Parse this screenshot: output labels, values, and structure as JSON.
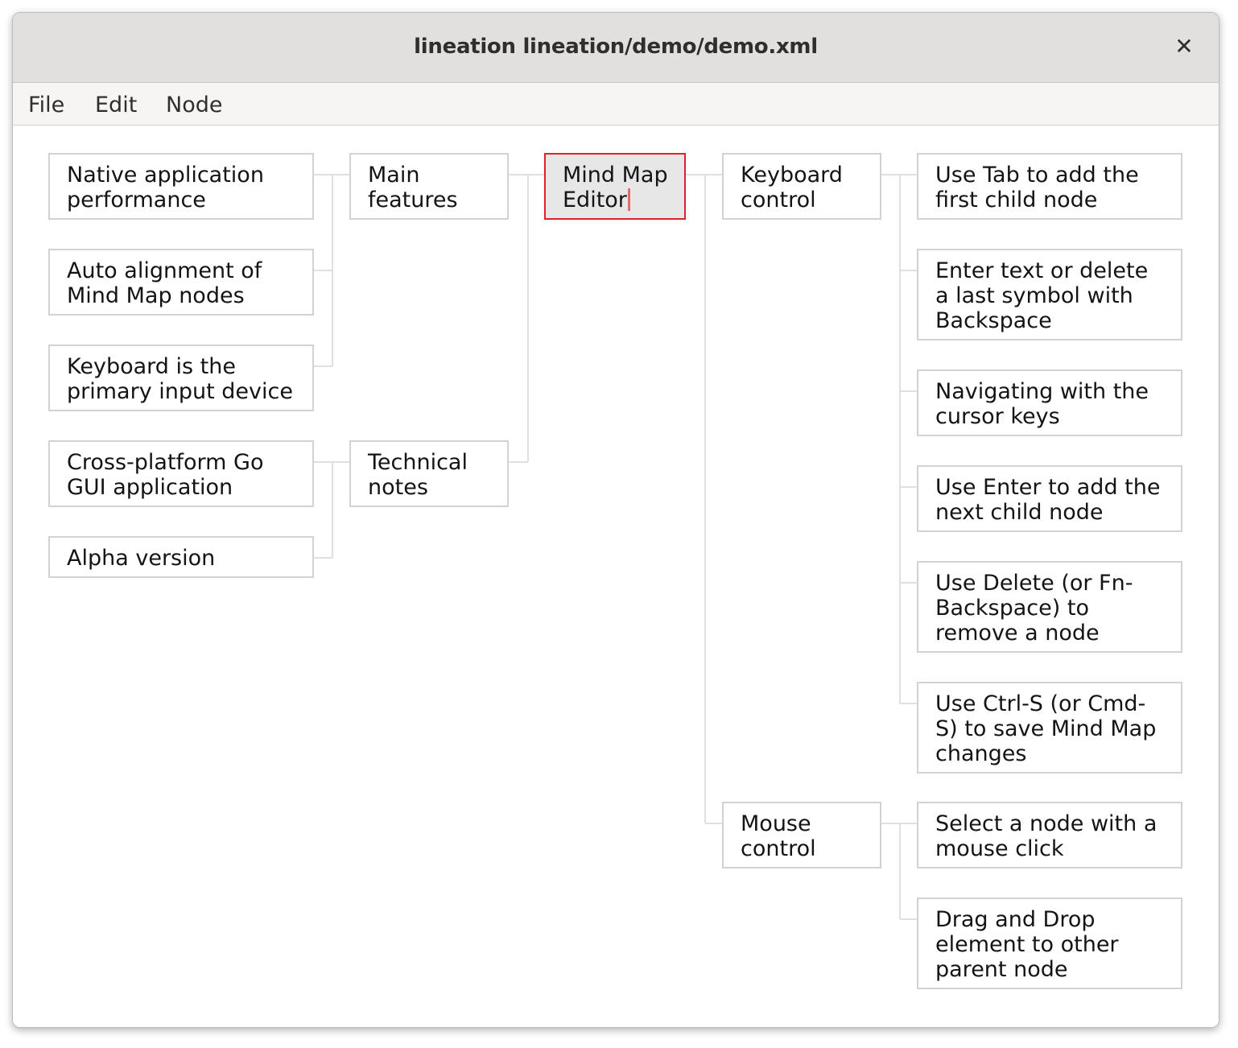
{
  "window": {
    "title": "lineation lineation/demo/demo.xml",
    "close_glyph": "✕"
  },
  "menu": {
    "items": [
      "File",
      "Edit",
      "Node"
    ]
  },
  "mindmap": {
    "root": "Mind Map Editor",
    "root_line1": "Mind Map",
    "root_line2": "Editor",
    "left": {
      "main_features": {
        "label": "Main features",
        "children": [
          "Native application performance",
          "Auto alignment of Mind Map nodes",
          "Keyboard is the primary input device"
        ]
      },
      "technical_notes": {
        "label": "Technical notes",
        "children": [
          "Cross-platform Go GUI application",
          "Alpha version"
        ]
      }
    },
    "right": {
      "keyboard_control": {
        "label": "Keyboard control",
        "children": [
          "Use Tab to add the first child node",
          "Enter text or delete a last symbol with Backspace",
          "Navigating with the cursor keys",
          "Use Enter to add the next child node",
          "Use Delete (or Fn-Backspace) to remove a node",
          "Use Ctrl-S (or Cmd-S) to save Mind Map changes"
        ]
      },
      "mouse_control": {
        "label": "Mouse control",
        "children": [
          "Select a node with a mouse click",
          "Drag and Drop element to other parent node"
        ]
      }
    }
  },
  "colors": {
    "selected_border": "#e0202a",
    "node_border": "#d2d2d2",
    "connector": "#e0e0e0"
  }
}
